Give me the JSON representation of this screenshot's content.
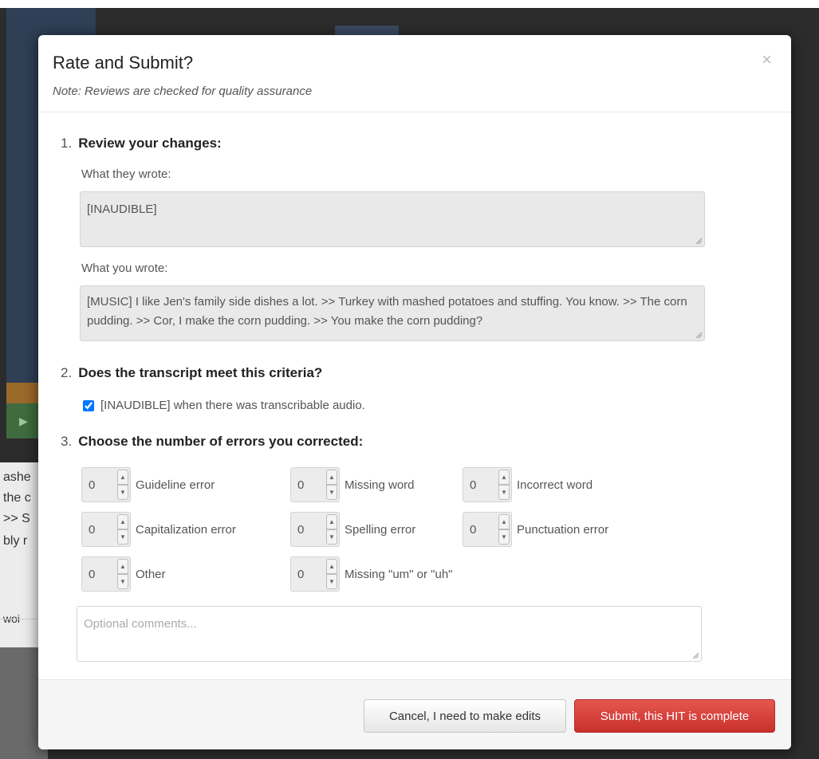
{
  "modal": {
    "title": "Rate and Submit?",
    "note": "Note: Reviews are checked for quality assurance",
    "close_glyph": "×"
  },
  "sections": {
    "review": {
      "number": "1.",
      "title": "Review your changes:",
      "they_wrote_label": "What they wrote:",
      "they_wrote_value": "[INAUDIBLE]",
      "you_wrote_label": "What you wrote:",
      "you_wrote_value": "[MUSIC] I like Jen's family side dishes a lot. >> Turkey with mashed potatoes and stuffing. You know. >> The corn pudding. >> Cor, I make the corn pudding. >> You make the corn pudding?"
    },
    "criteria": {
      "number": "2.",
      "title": "Does the transcript meet this criteria?",
      "checkbox_label": "[INAUDIBLE] when there was transcribable audio.",
      "checked": true
    },
    "errors": {
      "number": "3.",
      "title": "Choose the number of errors you corrected:",
      "items": [
        {
          "label": "Guideline error",
          "value": "0"
        },
        {
          "label": "Missing word",
          "value": "0"
        },
        {
          "label": "Incorrect word",
          "value": "0"
        },
        {
          "label": "Capitalization error",
          "value": "0"
        },
        {
          "label": "Spelling error",
          "value": "0"
        },
        {
          "label": "Punctuation error",
          "value": "0"
        },
        {
          "label": "Other",
          "value": "0"
        },
        {
          "label": "Missing \"um\" or \"uh\"",
          "value": "0"
        }
      ]
    },
    "comments_placeholder": "Optional comments..."
  },
  "buttons": {
    "cancel_label": "Cancel, I need to make edits",
    "submit_label": "Submit, this HIT is complete"
  },
  "background_fragments": [
    "ashe",
    "the c",
    ">> S",
    "bly r",
    "woi"
  ],
  "colors": {
    "submit": "#d9534f",
    "backdrop": "#2c2c2c"
  },
  "icons": {
    "close": "close-icon",
    "spinner": "spinner-arrows-icon",
    "resize": "resize-grip-icon",
    "play": "play-icon"
  }
}
